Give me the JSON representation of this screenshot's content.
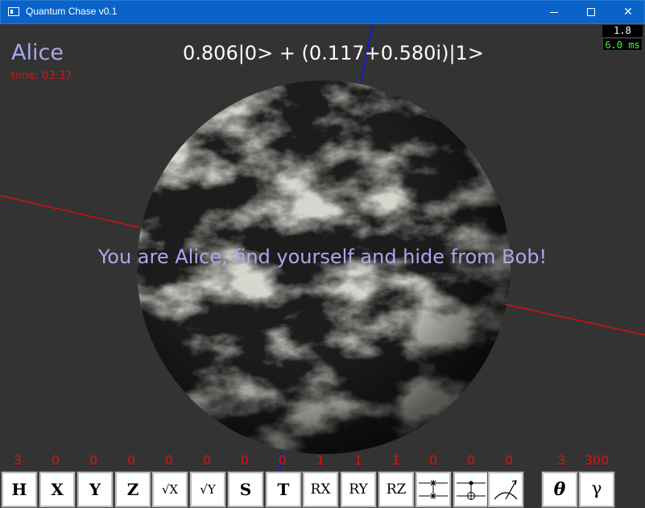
{
  "window": {
    "title": "Quantum Chase v0.1"
  },
  "hud": {
    "player": "Alice",
    "time": "time: 03:37",
    "state": "0.806|0> + (0.117+0.580i)|1>",
    "fps": "1.8 fps",
    "ms": "6.0 ms",
    "message": "You are Alice, find yourself and hide from Bob!"
  },
  "colors": {
    "accent_text": "#aaa8ee",
    "counter": "#e01010",
    "axis_x": "#d01010",
    "axis_z": "#1a1acc",
    "title_bar": "#0a63c9"
  },
  "gates": [
    {
      "label": "H",
      "count": "3"
    },
    {
      "label": "X",
      "count": "0"
    },
    {
      "label": "Y",
      "count": "0"
    },
    {
      "label": "Z",
      "count": "0"
    },
    {
      "label": "√X",
      "count": "0"
    },
    {
      "label": "√Y",
      "count": "0"
    },
    {
      "label": "S",
      "count": "0"
    },
    {
      "label": "T",
      "count": "0"
    },
    {
      "label": "RX",
      "count": "1"
    },
    {
      "label": "RY",
      "count": "1"
    },
    {
      "label": "RZ",
      "count": "1"
    },
    {
      "label": "swap-gate-icon",
      "count": "0"
    },
    {
      "label": "cnot-gate-icon",
      "count": "0"
    },
    {
      "label": "measure-gate-icon",
      "count": "0"
    }
  ],
  "params": [
    {
      "label": "θ",
      "count": "3"
    },
    {
      "label": "γ",
      "count": "300"
    }
  ]
}
